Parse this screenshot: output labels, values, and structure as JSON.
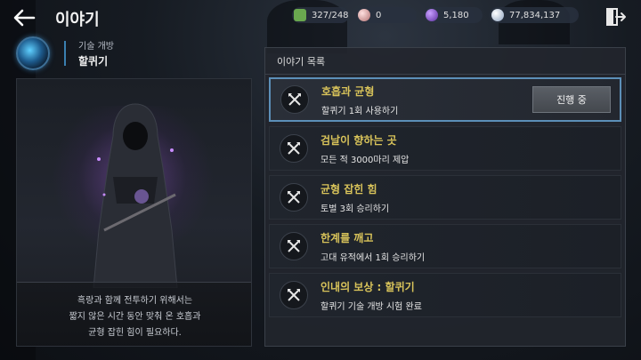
{
  "header": {
    "title": "이야기",
    "back_icon": "arrow-left-icon",
    "exit_icon": "exit-door-icon"
  },
  "currencies": {
    "stamina": {
      "icon": "stamina-icon",
      "value": "327/248"
    },
    "pearl": {
      "icon": "pearl-icon",
      "value": "0"
    },
    "gem": {
      "icon": "purple-gem-icon",
      "value": "5,180"
    },
    "silver": {
      "icon": "silver-coin-icon",
      "value": "77,834,137"
    }
  },
  "skill": {
    "category": "기술 개방",
    "name": "할퀴기",
    "icon": "claw-skill-icon"
  },
  "portrait": {
    "caption_lines": [
      "흑랑과 함께 전투하기 위해서는",
      "짧지 않은 시간 동안 맞춰 온 호흡과",
      "균형 잡힌 힘이 필요하다."
    ]
  },
  "story": {
    "header": "이야기 목록",
    "quests": [
      {
        "name": "호흡과 균형",
        "desc": "할퀴기 1회 사용하기",
        "status": "진행 중",
        "icon": "crossed-axes-icon"
      },
      {
        "name": "검날이 향하는 곳",
        "desc": "모든 적 3000마리 제압",
        "icon": "crossed-axes-icon"
      },
      {
        "name": "균형 잡힌 힘",
        "desc": "토벌 3회 승리하기",
        "icon": "crossed-axes-icon"
      },
      {
        "name": "한계를 깨고",
        "desc": "고대 유적에서 1회 승리하기",
        "icon": "crossed-axes-icon"
      },
      {
        "name": "인내의 보상 : 할퀴기",
        "desc": "할퀴기 기술 개방 시험 완료",
        "icon": "crossed-axes-icon"
      }
    ]
  },
  "colors": {
    "quest_title": "#d8c35a",
    "active_border": "#5c8fb8",
    "accent_blue": "#3a7fb0"
  }
}
